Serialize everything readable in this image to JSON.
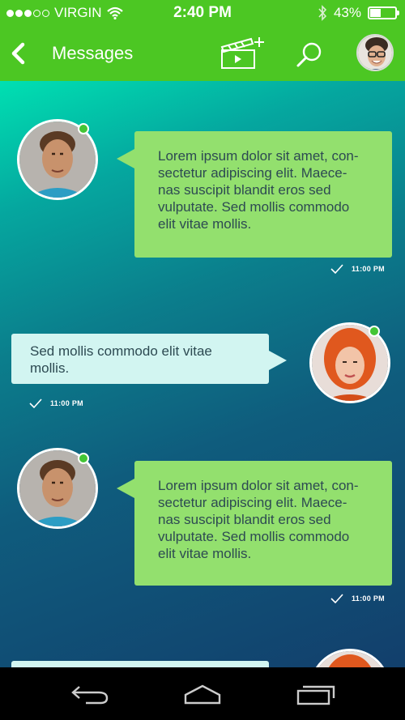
{
  "status_bar": {
    "carrier": "VIRGIN",
    "time": "2:40 PM",
    "battery_percent": "43%",
    "battery_level": 0.43,
    "signal_strength": 3,
    "signal_max": 5
  },
  "app_bar": {
    "title": "Messages",
    "back_icon": "chevron-left-icon",
    "clapperboard_icon": "clapperboard-add-icon",
    "search_icon": "search-icon"
  },
  "messages": [
    {
      "direction": "incoming",
      "text": "Lorem ipsum dolor sit amet, con-\nsectetur adipiscing elit. Maece-\nnas suscipit blandit eros sed\nvulputate. Sed mollis commodo\nelit vitae mollis.",
      "time": "11:00 PM",
      "sender": "male",
      "online": true
    },
    {
      "direction": "outgoing",
      "text": "Sed mollis commodo elit vitae\nmollis.",
      "time": "11:00 PM",
      "sender": "female",
      "online": true
    },
    {
      "direction": "incoming",
      "text": "Lorem ipsum dolor sit amet, con-\nsectetur adipiscing elit. Maece-\nnas suscipit blandit eros sed\nvulputate. Sed mollis commodo\nelit vitae mollis.",
      "time": "11:00 PM",
      "sender": "male",
      "online": true
    },
    {
      "direction": "outgoing",
      "text": "",
      "time": "",
      "sender": "female",
      "online": false
    }
  ],
  "nav_bar": {
    "back_icon": "android-back-icon",
    "home_icon": "android-home-icon",
    "recents_icon": "android-recents-icon"
  },
  "colors": {
    "accent": "#4cc723",
    "incoming_bubble": "#93e06e",
    "outgoing_bubble": "#d2f5f1",
    "online": "#43c535"
  }
}
